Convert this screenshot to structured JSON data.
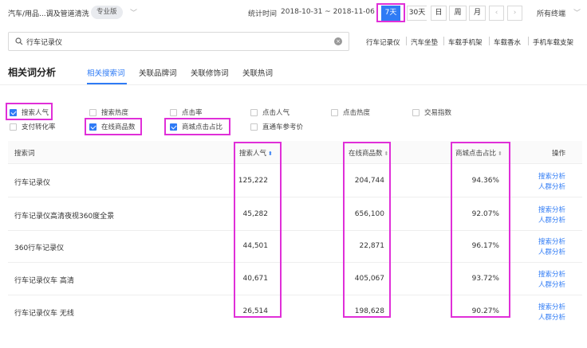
{
  "topbar": {
    "category": "汽车/用品...调及管道清洗",
    "badge": "专业版",
    "stat_label": "统计时间",
    "date_range": "2018-10-31 ~ 2018-11-06",
    "periods": [
      "7天",
      "30天",
      "日",
      "周",
      "月"
    ],
    "prev": "‹",
    "next": "›",
    "terminal": "所有终端"
  },
  "search": {
    "value": "行车记录仪",
    "keywords": [
      "行车记录仪",
      "汽车坐垫",
      "车载手机架",
      "车载香水",
      "手机车载支架"
    ]
  },
  "section": {
    "title": "相关词分析",
    "tabs": [
      "相关搜索词",
      "关联品牌词",
      "关联修饰词",
      "关联热词"
    ]
  },
  "metrics": [
    {
      "label": "搜索人气",
      "checked": true
    },
    {
      "label": "搜索热度",
      "checked": false
    },
    {
      "label": "点击率",
      "checked": false
    },
    {
      "label": "点击人气",
      "checked": false
    },
    {
      "label": "点击热度",
      "checked": false
    },
    {
      "label": "交易指数",
      "checked": false
    },
    {
      "label": "支付转化率",
      "checked": false
    },
    {
      "label": "在线商品数",
      "checked": true
    },
    {
      "label": "商城点击占比",
      "checked": true
    },
    {
      "label": "直通车参考价",
      "checked": false
    }
  ],
  "table": {
    "headers": {
      "keyword": "搜索词",
      "popularity": "搜索人气",
      "online": "在线商品数",
      "mall_ratio": "商城点击占比",
      "actions": "操作"
    },
    "rows": [
      {
        "keyword": "行车记录仪",
        "popularity": "125,222",
        "online": "204,744",
        "mall_ratio": "94.36%"
      },
      {
        "keyword": "行车记录仪高清夜视360度全景",
        "popularity": "45,282",
        "online": "656,100",
        "mall_ratio": "92.07%"
      },
      {
        "keyword": "360行车记录仪",
        "popularity": "44,501",
        "online": "22,871",
        "mall_ratio": "96.17%"
      },
      {
        "keyword": "行车记录仪车 高清",
        "popularity": "40,671",
        "online": "405,067",
        "mall_ratio": "93.72%"
      },
      {
        "keyword": "行车记录仪车 无线",
        "popularity": "26,514",
        "online": "198,628",
        "mall_ratio": "90.27%"
      }
    ],
    "action_search": "搜索分析",
    "action_crowd": "人群分析"
  },
  "colors": {
    "accent": "#2f7bf5",
    "highlight": "#e02fd8"
  }
}
